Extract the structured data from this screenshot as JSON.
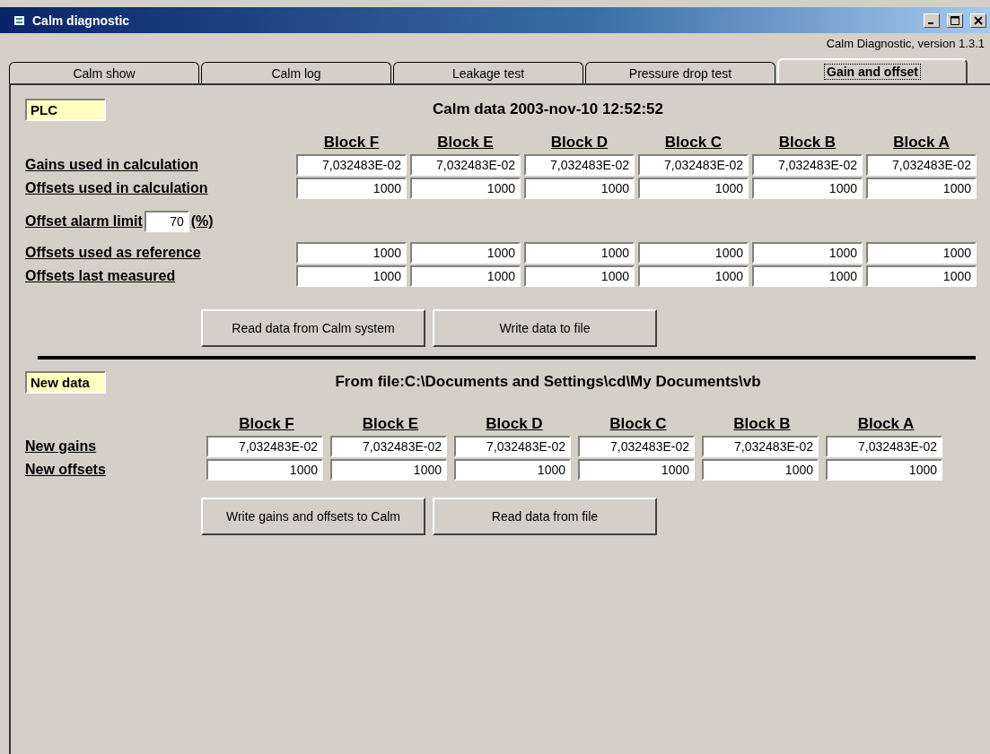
{
  "window": {
    "title": "Calm diagnostic"
  },
  "version": "Calm Diagnostic, version 1.3.1",
  "tabs": [
    {
      "label": "Calm show",
      "selected": false
    },
    {
      "label": "Calm log",
      "selected": false
    },
    {
      "label": "Leakage test",
      "selected": false
    },
    {
      "label": "Pressure drop test",
      "selected": false
    },
    {
      "label": "Gain and offset",
      "selected": true
    }
  ],
  "plc": {
    "badge": "PLC",
    "heading": "Calm data 2003-nov-10 12:52:52",
    "columns": [
      "Block F",
      "Block E",
      "Block D",
      "Block C",
      "Block B",
      "Block A"
    ],
    "rows": [
      {
        "label": "Gains used in calculation",
        "values": [
          "7,032483E-02",
          "7,032483E-02",
          "7,032483E-02",
          "7,032483E-02",
          "7,032483E-02",
          "7,032483E-02"
        ]
      },
      {
        "label": "Offsets used in calculation",
        "values": [
          "1000",
          "1000",
          "1000",
          "1000",
          "1000",
          "1000"
        ]
      }
    ],
    "alarm": {
      "label": "Offset alarm limit",
      "value": "70",
      "unit": "(%)"
    },
    "rows2": [
      {
        "label": "Offsets used as reference",
        "values": [
          "1000",
          "1000",
          "1000",
          "1000",
          "1000",
          "1000"
        ]
      },
      {
        "label": "Offsets last measured",
        "values": [
          "1000",
          "1000",
          "1000",
          "1000",
          "1000",
          "1000"
        ]
      }
    ],
    "buttons": [
      "Read data from Calm system",
      "Write data to file"
    ]
  },
  "new_data": {
    "badge": "New data",
    "heading": "From file:C:\\Documents and Settings\\cd\\My Documents\\vb",
    "columns": [
      "Block F",
      "Block E",
      "Block D",
      "Block C",
      "Block B",
      "Block A"
    ],
    "rows": [
      {
        "label": "New gains",
        "values": [
          "7,032483E-02",
          "7,032483E-02",
          "7,032483E-02",
          "7,032483E-02",
          "7,032483E-02",
          "7,032483E-02"
        ]
      },
      {
        "label": "New offsets",
        "values": [
          "1000",
          "1000",
          "1000",
          "1000",
          "1000",
          "1000"
        ]
      }
    ],
    "buttons": [
      "Write gains and offsets to Calm",
      "Read data from file"
    ]
  }
}
